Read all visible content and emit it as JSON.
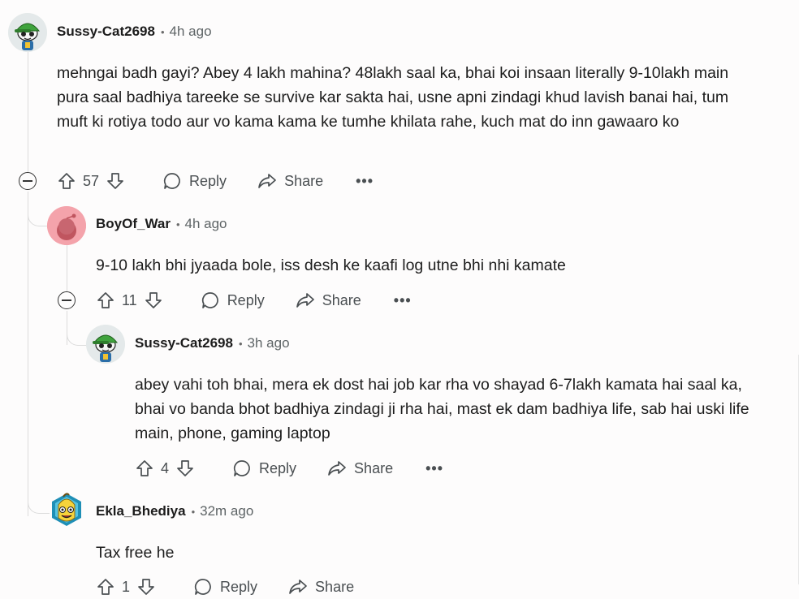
{
  "comments": [
    {
      "user": "Sussy-Cat2698",
      "time": "4h ago",
      "body": "mehngai badh gayi? Abey 4 lakh mahina? 48lakh saal ka, bhai koi insaan literally 9-10lakh main pura saal badhiya tareeke se survive kar sakta hai, usne apni zindagi khud lavish banai hai, tum muft ki rotiya todo aur vo kama kama ke tumhe khilata rahe, kuch mat do inn gawaaro ko",
      "score": "57",
      "avatar": "snoo-green-cap-icon"
    },
    {
      "user": "BoyOf_War",
      "time": "4h ago",
      "body": "9-10 lakh bhi jyaada bole, iss desh ke kaafi log utne bhi nhi kamate",
      "score": "11",
      "avatar": "snoo-default-pink-icon"
    },
    {
      "user": "Sussy-Cat2698",
      "time": "3h ago",
      "body": "abey vahi toh bhai, mera ek dost hai job kar rha vo shayad 6-7lakh kamata hai saal ka, bhai vo banda bhot badhiya zindagi ji rha hai, mast ek dam badhiya life, sab hai uski life main, phone, gaming laptop",
      "score": "4",
      "avatar": "snoo-green-cap-icon"
    },
    {
      "user": "Ekla_Bhediya",
      "time": "32m ago",
      "body": "Tax free he",
      "score": "1",
      "avatar": "snoo-banana-icon"
    }
  ],
  "actions": {
    "reply": "Reply",
    "share": "Share",
    "more": "•••"
  },
  "colors": {
    "background": "#fdfcfc",
    "text": "#1c1c1c",
    "meta": "#5e6466",
    "thread_line": "#dcdcdc"
  }
}
